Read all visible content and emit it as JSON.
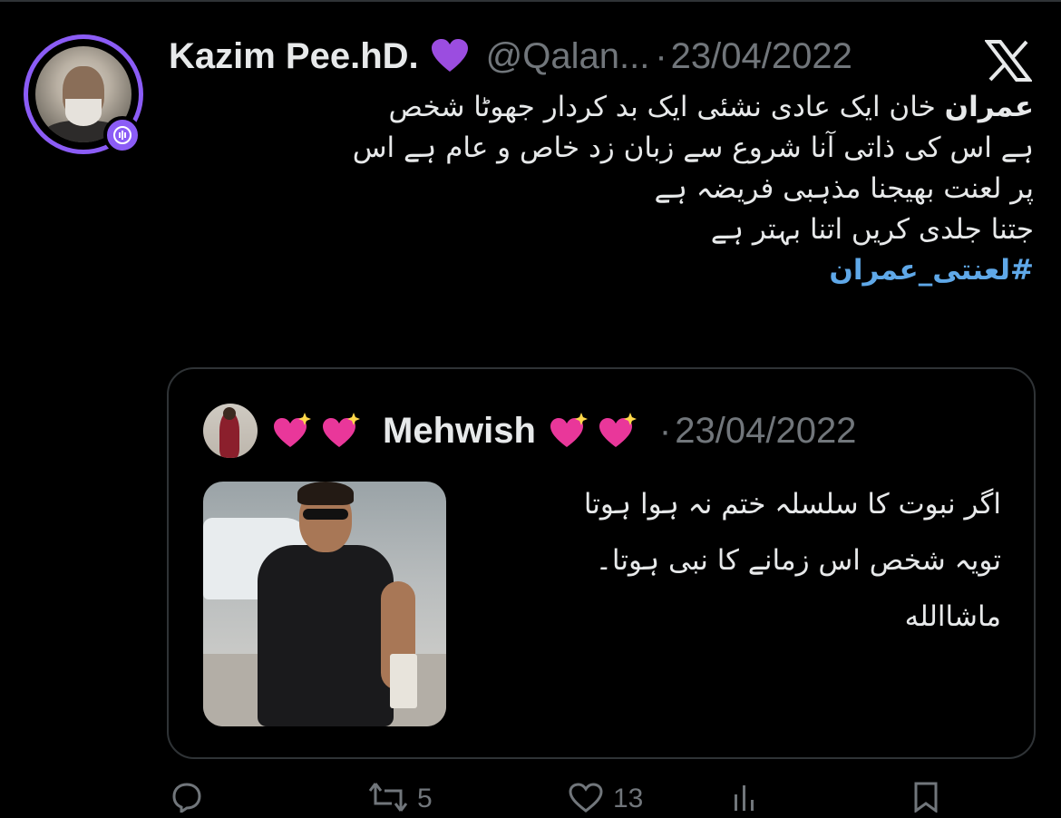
{
  "tweet": {
    "author": {
      "display_name": "Kazim Pee.hD.",
      "handle": "@Qalan...",
      "date": "23/04/2022"
    },
    "separator": "·",
    "text_lines": [
      {
        "bold": "عمران",
        "rest": " خان ایک عادی نشئی ایک بد کردار جھوٹا شخص"
      },
      {
        "text": "ہے اس کی ذاتی آنا شروع سے زبان زد خاص و عام ہے اس"
      },
      {
        "text": "پر لعنت بھیجنا مذہبی فریضہ ہے"
      },
      {
        "text": "جتنا جلدی کریں اتنا بہتر ہے"
      }
    ],
    "hashtag": "#لعنتی_عمران"
  },
  "quote": {
    "display_name": "Mehwish",
    "separator": "·",
    "date": "23/04/2022",
    "text_lines": [
      "اگر نبوت کا سلسلہ ختم نہ ہوا ہوتا",
      "تویہ شخص اس زمانے کا نبی ہوتا۔",
      "ماشاالله"
    ]
  },
  "actions": {
    "reply_count": "",
    "retweet_count": "5",
    "like_count": "13"
  },
  "colors": {
    "background": "#000000",
    "text": "#e7e9ea",
    "muted": "#71767b",
    "hashtag": "#5fa8e8",
    "border": "#2f3336",
    "avatar_ring": "#8b5cf6"
  },
  "icons": [
    "purple-heart-icon",
    "verified-voice-badge-icon",
    "x-logo-icon",
    "sparkling-heart-icon"
  ]
}
